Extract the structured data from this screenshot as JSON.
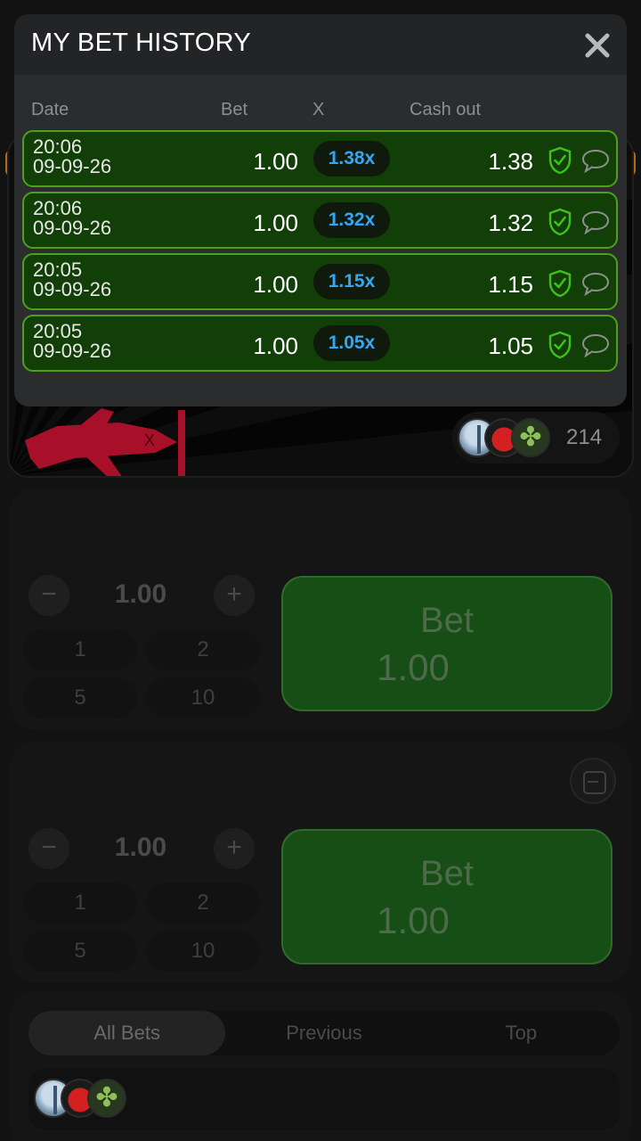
{
  "modal": {
    "title": "MY BET HISTORY",
    "columns": {
      "date": "Date",
      "bet": "Bet",
      "x": "X",
      "cashout": "Cash out"
    },
    "rows": [
      {
        "time": "20:06",
        "date": "09-09-26",
        "bet": "1.00",
        "multiplier": "1.38x",
        "cashout": "1.38"
      },
      {
        "time": "20:06",
        "date": "09-09-26",
        "bet": "1.00",
        "multiplier": "1.32x",
        "cashout": "1.32"
      },
      {
        "time": "20:05",
        "date": "09-09-26",
        "bet": "1.00",
        "multiplier": "1.15x",
        "cashout": "1.15"
      },
      {
        "time": "20:05",
        "date": "09-09-26",
        "bet": "1.00",
        "multiplier": "1.05x",
        "cashout": "1.05"
      }
    ]
  },
  "game": {
    "players_count": "214"
  },
  "bet_panel_1": {
    "amount": "1.00",
    "quick": [
      "1",
      "2",
      "5",
      "10"
    ],
    "bet_label": "Bet",
    "bet_value": "1.00"
  },
  "bet_panel_2": {
    "amount": "1.00",
    "quick": [
      "1",
      "2",
      "5",
      "10"
    ],
    "bet_label": "Bet",
    "bet_value": "1.00"
  },
  "bets_tabs": {
    "all": "All Bets",
    "previous": "Previous",
    "top": "Top"
  },
  "colors": {
    "row_bg": "#123f07",
    "row_border": "#4e9f1b",
    "multiplier_blue": "#35a6f2",
    "check_green": "#3ec01f"
  }
}
